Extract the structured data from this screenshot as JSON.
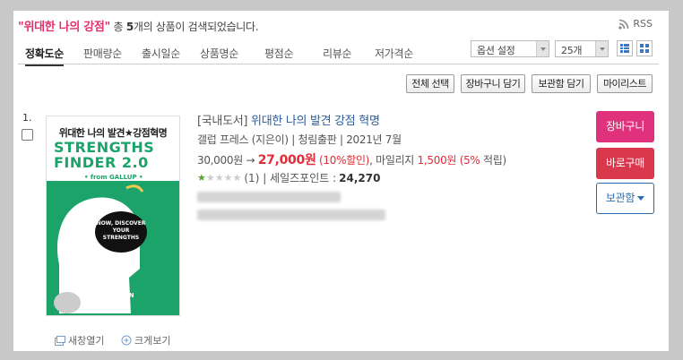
{
  "search": {
    "keyword": "\"위대한 나의 강점\"",
    "prefix": " 총 ",
    "count": "5",
    "suffix": "개의 상품이 검색되었습니다.",
    "rss_label": "RSS"
  },
  "sort": {
    "items": [
      "정확도순",
      "판매량순",
      "출시일순",
      "상품명순",
      "평점순",
      "리뷰순",
      "저가격순"
    ],
    "option_select": "옵션 설정",
    "per_page_select": "25개"
  },
  "actions": {
    "select_all": "전체 선택",
    "add_cart": "장바구니 담기",
    "add_locker": "보관함 담기",
    "my_list": "마이리스트"
  },
  "product": {
    "rank": "1.",
    "category": "[국내도서]",
    "title": "위대한 나의 발견 강점 혁명",
    "meta": "갤럽 프레스 (지은이) | 청림출판 | 2021년 7월",
    "list_price": "30,000원 → ",
    "sale_price": "27,000원",
    "discount": "(10%할인)",
    "mileage_prefix": ", 마일리지 ",
    "mileage": "1,500원",
    "mileage_pct": "(5%",
    "mileage_suffix": " 적립)",
    "rating_count": "(1) | 세일즈포인트 : ",
    "sales_point": "24,270",
    "rating": 1,
    "rating_max": 5,
    "cover": {
      "title_kr": "위대한 나의 발견★강점혁명",
      "big_line1": "STRENGTHS",
      "big_line2": "FINDER 2.0",
      "from": "• from GALLUP •",
      "bubble": "NOW, DISCOVER YOUR STRENGTHS",
      "author": "DON CLIFTON"
    },
    "new_window": "새창열기",
    "zoom": "크게보기"
  },
  "buttons": {
    "cart": "장바구니",
    "buy": "바로구매",
    "save": "보관함"
  },
  "colors": {
    "keyword": "#e0316f",
    "sale": "#e02d38",
    "title": "#2b5c9e",
    "cart_btn": "#e0317c",
    "buy_btn": "#d9384d",
    "star_on": "#55a530"
  }
}
